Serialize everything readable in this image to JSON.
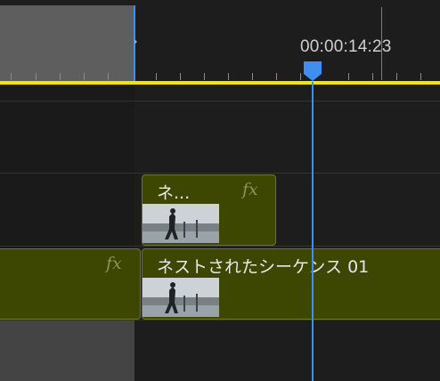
{
  "timeline": {
    "timecode": "00:00:14:23",
    "playhead_icon": "playhead-marker-icon",
    "in_point_icon": "chevron-right-icon"
  },
  "clips": {
    "upper_nested_title": "ネ...",
    "lower_nested_title": "ネストされたシーケンス 01",
    "fx_label": "fx"
  },
  "colors": {
    "playhead": "#3f8ef0",
    "work_area_bar": "#f2e600",
    "clip_fill": "#3d4702",
    "clip_border": "#6b7a14"
  }
}
